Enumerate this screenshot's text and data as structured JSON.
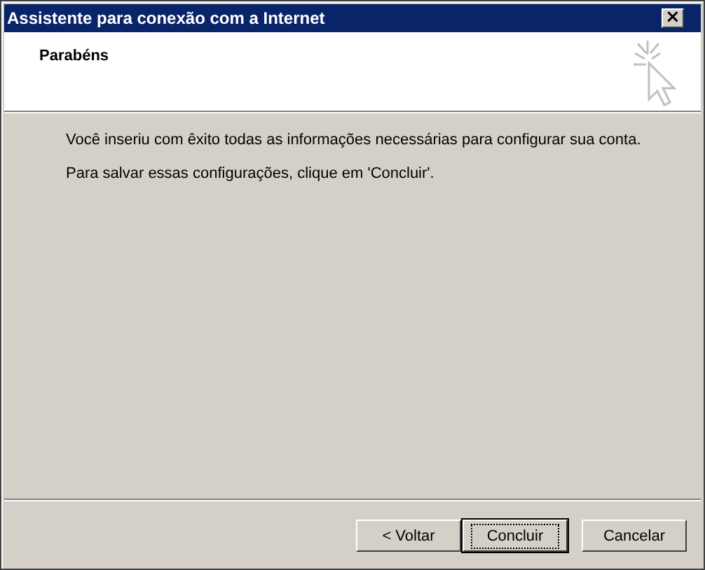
{
  "window": {
    "title": "Assistente para conexão com a Internet",
    "close": "×"
  },
  "header": {
    "title": "Parabéns"
  },
  "body": {
    "paragraphs": [
      "Você inseriu com êxito todas as informações necessárias para configurar sua conta.",
      "Para salvar essas configurações, clique em 'Concluir'."
    ]
  },
  "buttons": [
    {
      "label": "< Voltar",
      "default": false
    },
    {
      "label": "Concluir",
      "default": true
    },
    {
      "label": "Cancelar",
      "default": false
    }
  ]
}
